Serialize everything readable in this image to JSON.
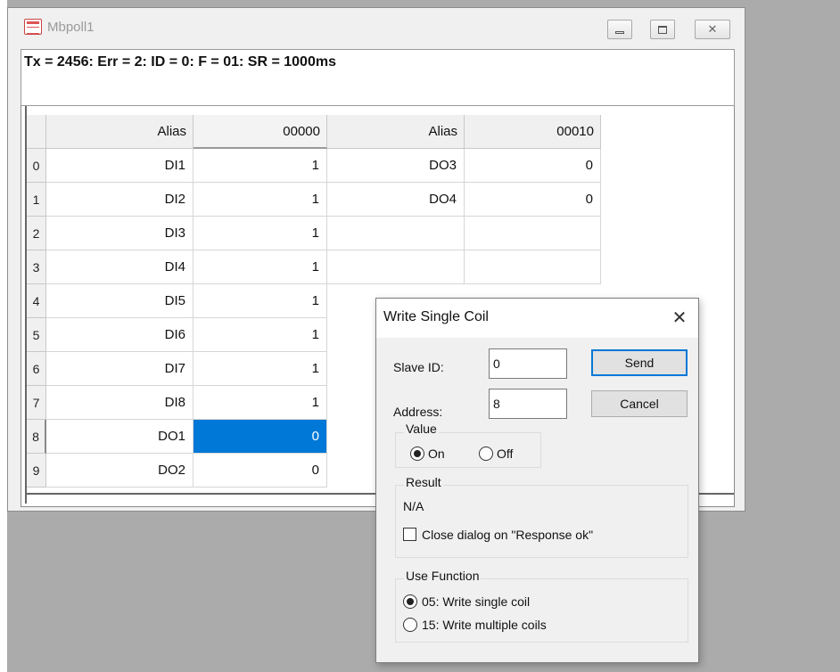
{
  "main_window": {
    "title": "Mbpoll1",
    "status_line": "Tx = 2456: Err = 2: ID = 0: F = 01: SR = 1000ms",
    "controls": {
      "minimize": "—",
      "maximize": "□",
      "close": "✕"
    }
  },
  "grid": {
    "columns": [
      {
        "header": "Alias"
      },
      {
        "header": "00000"
      },
      {
        "header": "Alias"
      },
      {
        "header": "00010"
      }
    ],
    "rows": [
      {
        "index": "0",
        "alias1": "DI1",
        "val1": "1",
        "alias2": "DO3",
        "val2": "0"
      },
      {
        "index": "1",
        "alias1": "DI2",
        "val1": "1",
        "alias2": "DO4",
        "val2": "0"
      },
      {
        "index": "2",
        "alias1": "DI3",
        "val1": "1",
        "alias2": "",
        "val2": ""
      },
      {
        "index": "3",
        "alias1": "DI4",
        "val1": "1",
        "alias2": "",
        "val2": ""
      },
      {
        "index": "4",
        "alias1": "DI5",
        "val1": "1",
        "alias2": "",
        "val2": ""
      },
      {
        "index": "5",
        "alias1": "DI6",
        "val1": "1",
        "alias2": "",
        "val2": ""
      },
      {
        "index": "6",
        "alias1": "DI7",
        "val1": "1",
        "alias2": "",
        "val2": ""
      },
      {
        "index": "7",
        "alias1": "DI8",
        "val1": "1",
        "alias2": "",
        "val2": ""
      },
      {
        "index": "8",
        "alias1": "DO1",
        "val1": "0",
        "alias2": "",
        "val2": ""
      },
      {
        "index": "9",
        "alias1": "DO2",
        "val1": "0",
        "alias2": "",
        "val2": ""
      }
    ],
    "selected_row": 8,
    "selection_color": "#0078d7"
  },
  "dialog": {
    "title": "Write Single Coil",
    "close_glyph": "✕",
    "slave_id_label": "Slave ID:",
    "slave_id_value": "0",
    "address_label": "Address:",
    "address_value": "8",
    "send_label": "Send",
    "cancel_label": "Cancel",
    "value_group": "Value",
    "value_on": "On",
    "value_off": "Off",
    "value_selected": "On",
    "result_group": "Result",
    "result_text": "N/A",
    "close_on_ok_label": "Close dialog on \"Response ok\"",
    "close_on_ok_checked": false,
    "function_group": "Use Function",
    "function_05": "05: Write single coil",
    "function_15": "15: Write multiple coils",
    "function_selected": "05"
  }
}
